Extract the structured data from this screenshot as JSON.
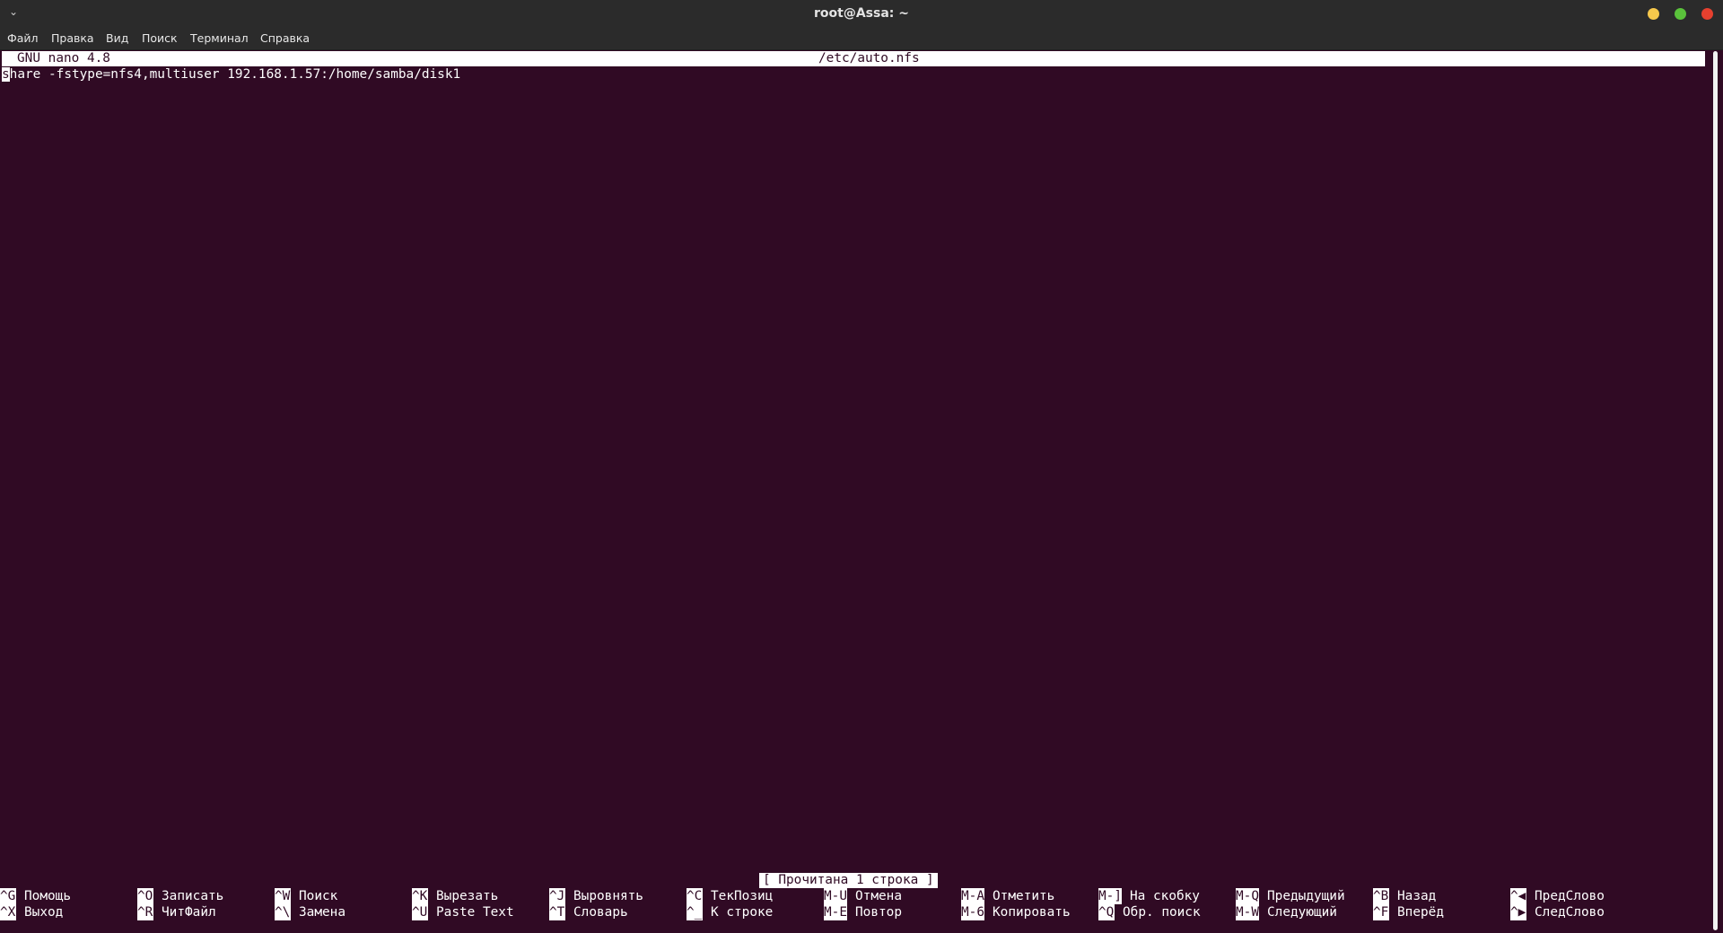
{
  "window": {
    "menu_arrow": "⌄",
    "title": "root@Assa: ~"
  },
  "menubar": {
    "items": [
      "Файл",
      "Правка",
      "Вид",
      "Поиск",
      "Терминал",
      "Справка"
    ]
  },
  "nano": {
    "version": "GNU nano 4.8",
    "filename": "/etc/auto.nfs",
    "line1_cursor_char": "s",
    "line1_rest": "hare -fstype=nfs4,multiuser 192.168.1.57:/home/samba/disk1",
    "status": "[ Прочитана 1 строка ]"
  },
  "shortcuts": {
    "row1": [
      {
        "key": "^G",
        "label": "Помощь"
      },
      {
        "key": "^O",
        "label": "Записать"
      },
      {
        "key": "^W",
        "label": "Поиск"
      },
      {
        "key": "^K",
        "label": "Вырезать"
      },
      {
        "key": "^J",
        "label": "Выровнять"
      },
      {
        "key": "^C",
        "label": "ТекПозиц"
      },
      {
        "key": "M-U",
        "label": "Отмена"
      },
      {
        "key": "M-A",
        "label": "Отметить"
      },
      {
        "key": "M-]",
        "label": "На скобку"
      },
      {
        "key": "M-Q",
        "label": "Предыдущий"
      },
      {
        "key": "^B",
        "label": "Назад"
      },
      {
        "key": "^◀",
        "label": "ПредСлово"
      }
    ],
    "row2": [
      {
        "key": "^X",
        "label": "Выход"
      },
      {
        "key": "^R",
        "label": "ЧитФайл"
      },
      {
        "key": "^\\",
        "label": "Замена"
      },
      {
        "key": "^U",
        "label": "Paste Text"
      },
      {
        "key": "^T",
        "label": "Словарь"
      },
      {
        "key": "^_",
        "label": "К строке"
      },
      {
        "key": "M-E",
        "label": "Повтор"
      },
      {
        "key": "M-6",
        "label": "Копировать"
      },
      {
        "key": "^Q",
        "label": "Обр. поиск"
      },
      {
        "key": "M-W",
        "label": "Следующий"
      },
      {
        "key": "^F",
        "label": "Вперёд"
      },
      {
        "key": "^▶",
        "label": "СледСлово"
      }
    ]
  }
}
